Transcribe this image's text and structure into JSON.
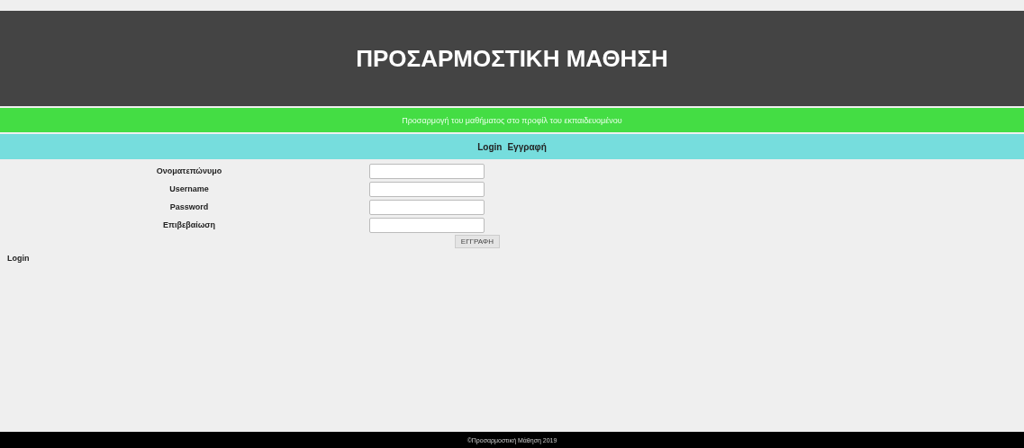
{
  "header": {
    "title": "ΠΡΟΣΑΡΜΟΣΤΙΚΗ ΜΑΘΗΣΗ"
  },
  "subtitle": "Προσαρμογή του μαθήματος στο προφίλ του εκπαιδευομένου",
  "nav": [
    {
      "label": "Login"
    },
    {
      "label": "Εγγραφή"
    }
  ],
  "form": {
    "fields": [
      {
        "label": "Ονοματεπώνυμο"
      },
      {
        "label": "Username"
      },
      {
        "label": "Password"
      },
      {
        "label": "Επιβεβαίωση"
      }
    ],
    "submit": "ΕΓΓΡΑΦΗ"
  },
  "login_link": "Login",
  "footer": "©Προσαρμοστική Μάθηση 2019"
}
